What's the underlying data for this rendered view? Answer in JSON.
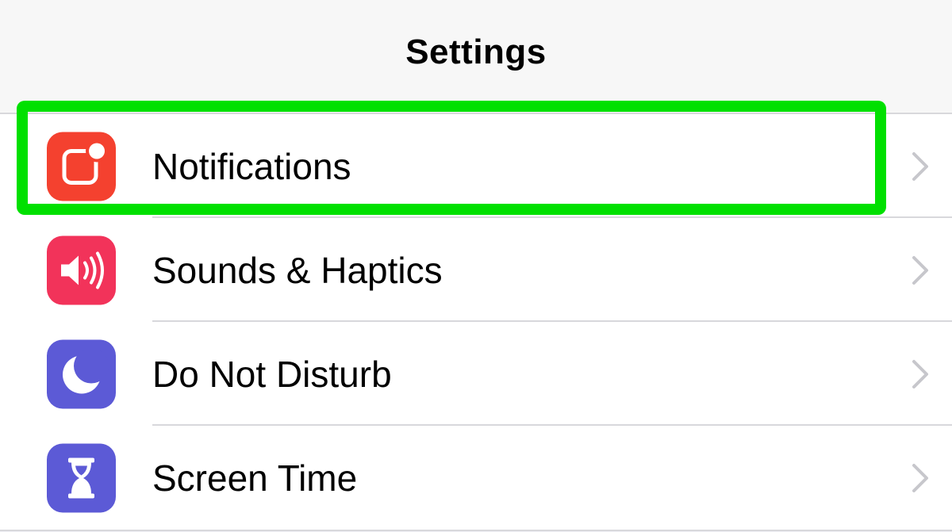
{
  "header": {
    "title": "Settings"
  },
  "rows": [
    {
      "label": "Notifications",
      "icon": "notifications-icon",
      "color": "#f4412f"
    },
    {
      "label": "Sounds & Haptics",
      "icon": "speaker-icon",
      "color": "#f2335a"
    },
    {
      "label": "Do Not Disturb",
      "icon": "moon-icon",
      "color": "#5c5ad6"
    },
    {
      "label": "Screen Time",
      "icon": "hourglass-icon",
      "color": "#5c5ad6"
    }
  ],
  "highlight": {
    "color": "#00e000",
    "target": "Notifications"
  }
}
